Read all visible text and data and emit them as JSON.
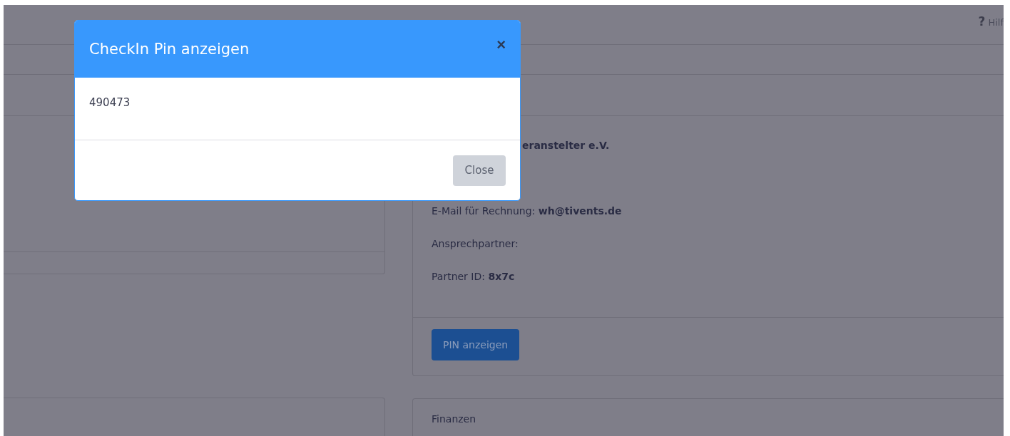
{
  "page": {
    "help": {
      "icon": "?",
      "label": "Hilf"
    },
    "details": [
      {
        "text": "**eranstelter e.V.**",
        "kind": "partial"
      },
      {
        "text": "E-Mail für Rechnung: **wh@tivents.de**",
        "kind": "gap"
      },
      {
        "text": "Ansprechpartner:",
        "kind": "line"
      },
      {
        "text": "Partner ID: **8x7c**",
        "kind": "line"
      }
    ],
    "pin_button": "PIN anzeigen",
    "finance_title": "Finanzen"
  },
  "modal": {
    "title": "CheckIn Pin anzeigen",
    "close_icon": "×",
    "pin": "490473",
    "close_button": "Close"
  }
}
